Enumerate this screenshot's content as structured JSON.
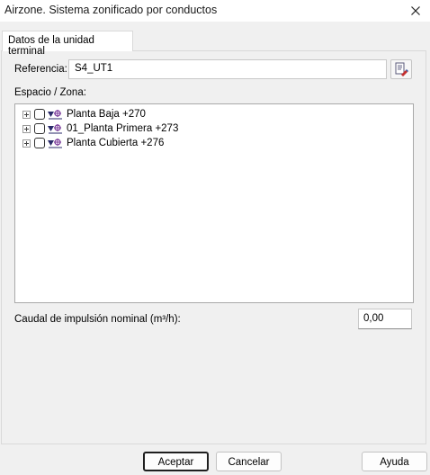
{
  "window": {
    "title": "Airzone. Sistema zonificado por conductos",
    "close_icon": "close-icon"
  },
  "tab": {
    "label": "Datos de la unidad terminal"
  },
  "reference": {
    "label": "Referencia:",
    "value": "S4_UT1",
    "button_icon": "edit-document-icon"
  },
  "space": {
    "label": "Espacio / Zona:",
    "nodes": [
      {
        "label": "Planta Baja +270"
      },
      {
        "label": "01_Planta Primera +273"
      },
      {
        "label": "Planta Cubierta +276"
      }
    ]
  },
  "flow": {
    "label": "Caudal de impulsión nominal (m³/h):",
    "value": "0,00"
  },
  "buttons": {
    "accept": "Aceptar",
    "cancel": "Cancelar",
    "help": "Ayuda"
  },
  "colors": {
    "zone_icon_purple": "#7a3a9a",
    "accent_border": "#1f1f1f"
  }
}
